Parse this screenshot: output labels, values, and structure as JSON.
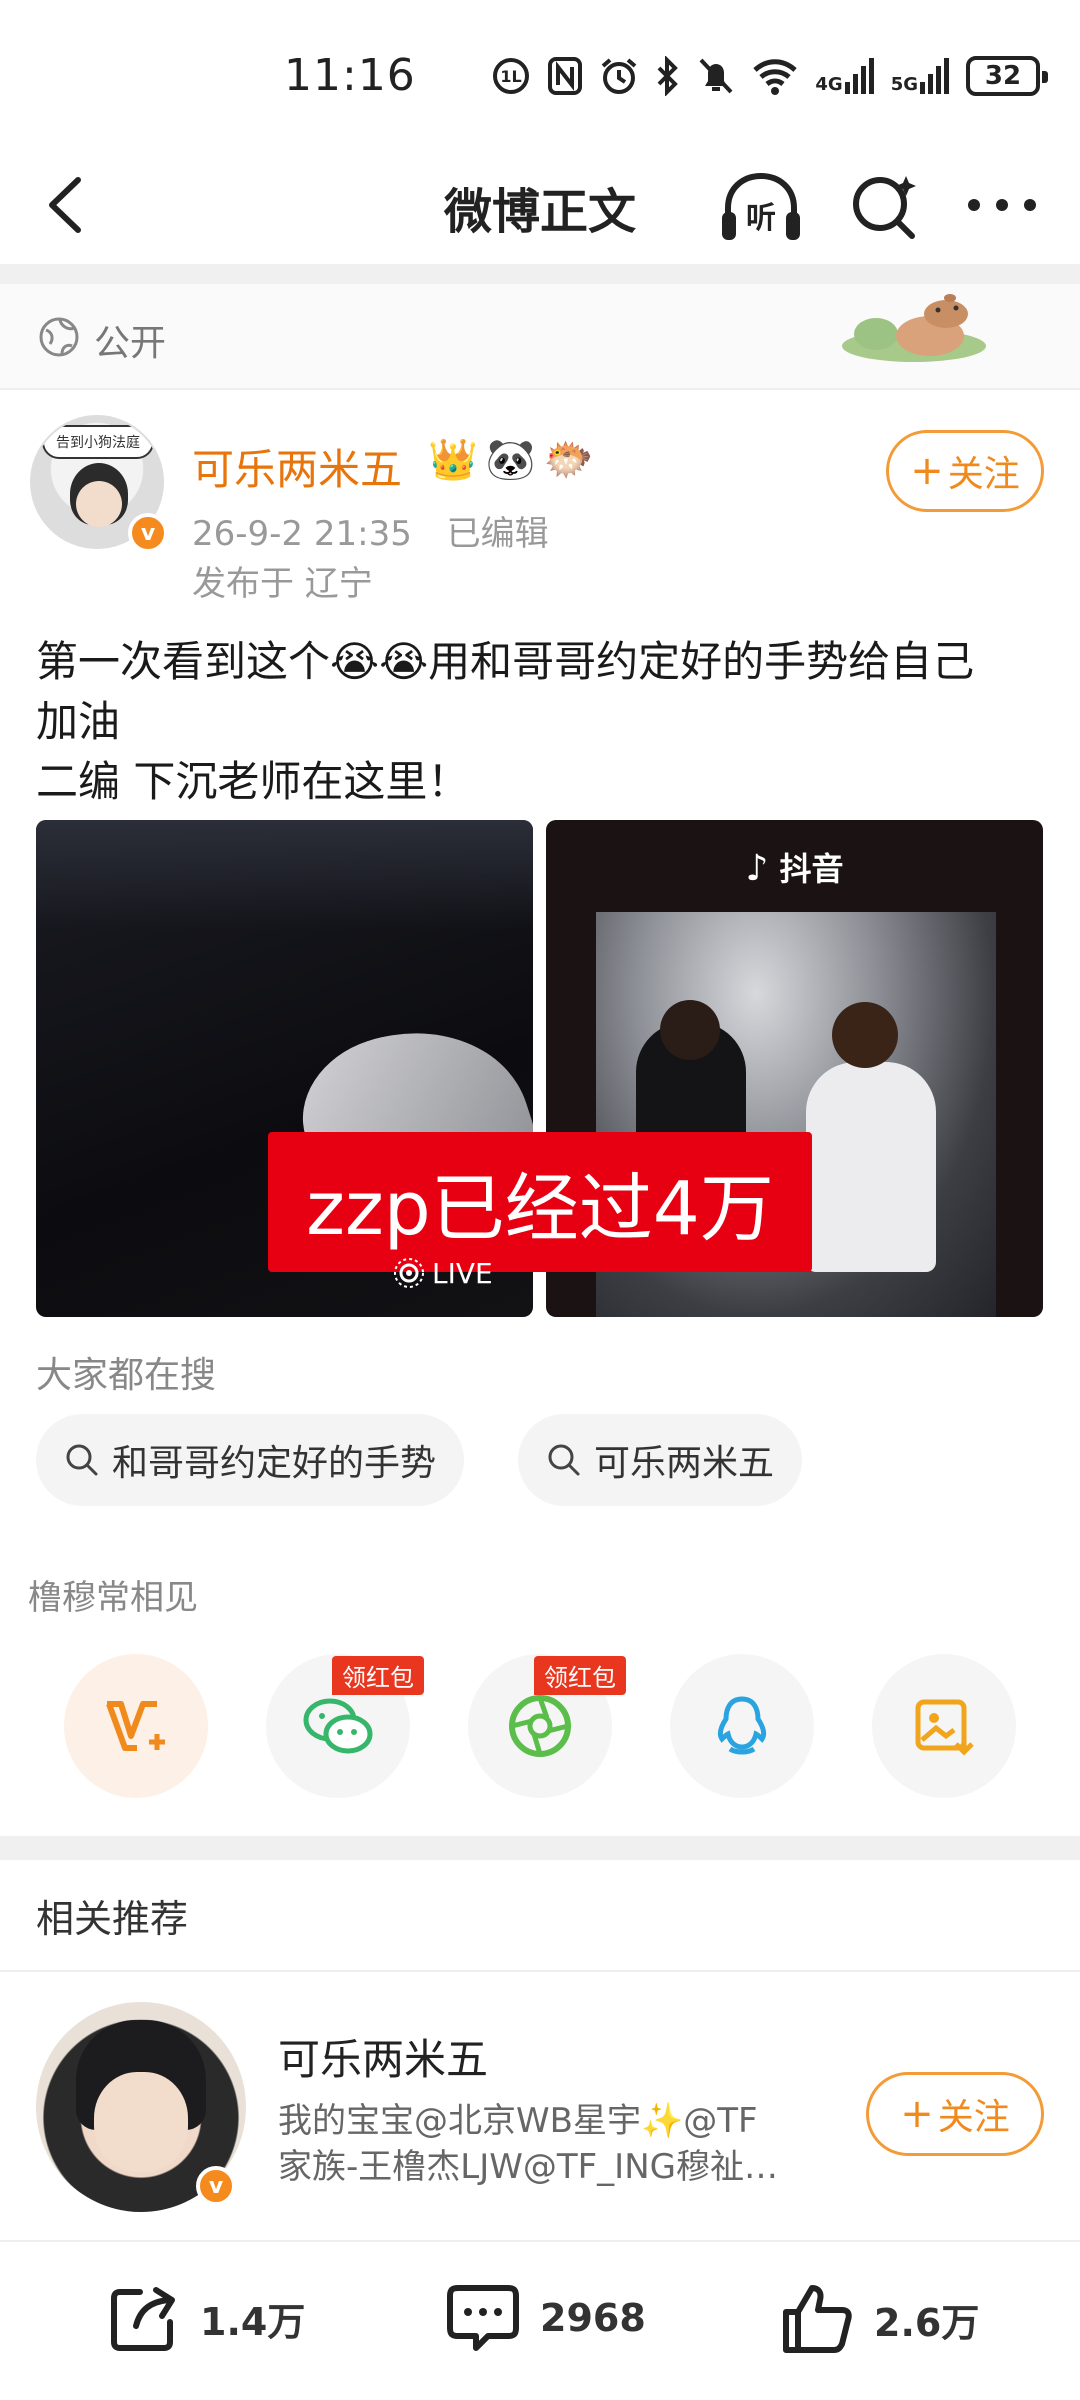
{
  "status_bar": {
    "time": "11:16",
    "battery": "32",
    "network_4g": "4G",
    "network_5g": "5G"
  },
  "nav": {
    "title": "微博正文",
    "listen_label": "听"
  },
  "visibility": {
    "label": "公开"
  },
  "post": {
    "avatar_caption": "告到小狗法庭",
    "author": "可乐两米五",
    "time": "26-9-2 21:35",
    "edited": "已编辑",
    "location": "发布于 辽宁",
    "follow_label": "关注",
    "text_line1": "第一次看到这个😭😭用和哥哥约定好的手势给自己",
    "text_line2": "加油",
    "text_line3": "二编 下沉老师在这里！",
    "live_label": "LIVE",
    "tiktok_label": "抖音",
    "banner": "zzp已经过4万"
  },
  "searching": {
    "title": "大家都在搜",
    "chips": [
      "和哥哥约定好的手势",
      "可乐两米五"
    ]
  },
  "share": {
    "title": "橹穆常相见",
    "tag": "领红包"
  },
  "recommend": {
    "title": "相关推荐",
    "name": "可乐两米五",
    "desc_line1": "我的宝宝@北京WB星宇✨@TF",
    "desc_line2": "家族-王橹杰LJW@TF_ING穆祉…",
    "follow_label": "关注"
  },
  "actions": {
    "repost": "1.4万",
    "comment": "2968",
    "like": "2.6万"
  },
  "colors": {
    "accent_orange": "#f08a1c",
    "banner_red": "#e60012",
    "tag_red": "#e8361f"
  }
}
